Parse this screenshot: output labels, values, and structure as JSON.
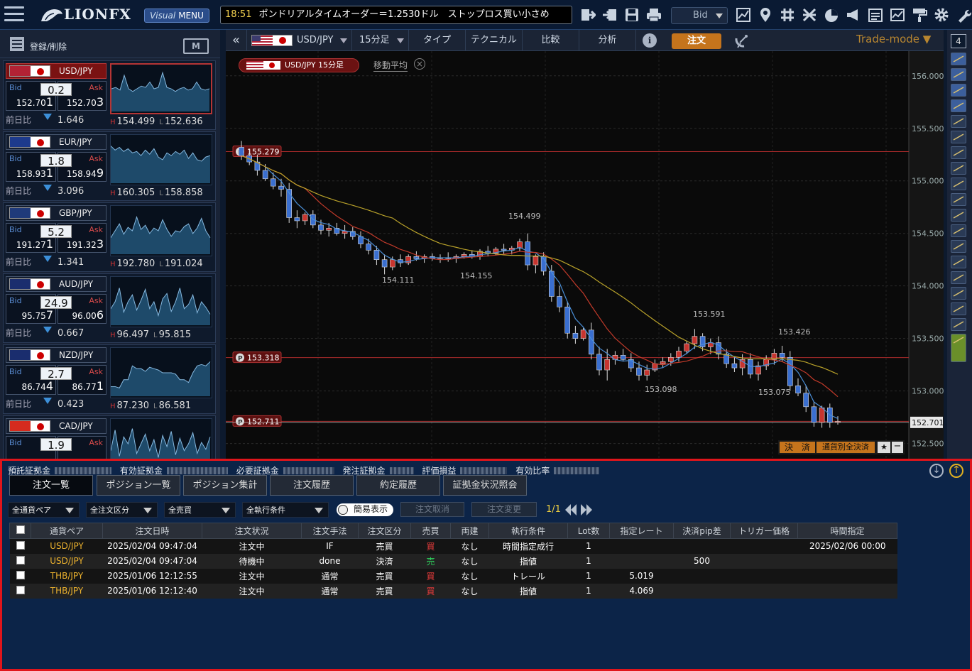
{
  "topbar": {
    "logo": "LIONFX",
    "visual_menu": {
      "italic": "Visual",
      "label": "MENU"
    },
    "ticker_time": "18:51",
    "ticker_text": "ポンドリアルタイムオーダー＝1.2530ドル　ストップロス買い小さめ",
    "bid_select": "Bid",
    "icons": [
      "logout-icon",
      "login-icon",
      "save-icon",
      "print-icon",
      "chart-icon",
      "map-pin-icon",
      "grid-icon",
      "scale-icon",
      "pie-icon",
      "megaphone-icon",
      "calendar-icon",
      "analysis-icon",
      "paint-roller-icon",
      "gear-icon",
      "wrench-icon"
    ]
  },
  "sidebar": {
    "label": "登録/削除",
    "m_label": "M",
    "pairs": [
      {
        "name": "USD/JPY",
        "spread": "0.2",
        "bid_main": "152.70",
        "bid_sub": "1",
        "ask_main": "152.70",
        "ask_sub": "3",
        "change": "1.646",
        "high": "154.499",
        "low": "152.636",
        "flag": "#b22234",
        "active": true
      },
      {
        "name": "EUR/JPY",
        "spread": "1.8",
        "bid_main": "158.93",
        "bid_sub": "1",
        "ask_main": "158.94",
        "ask_sub": "9",
        "change": "3.096",
        "high": "160.305",
        "low": "158.858",
        "flag": "#1d3a8c",
        "active": false
      },
      {
        "name": "GBP/JPY",
        "spread": "5.2",
        "bid_main": "191.27",
        "bid_sub": "1",
        "ask_main": "191.32",
        "ask_sub": "3",
        "change": "1.341",
        "high": "192.780",
        "low": "191.024",
        "flag": "#1f3a7a",
        "active": false
      },
      {
        "name": "AUD/JPY",
        "spread": "24.9",
        "bid_main": "95.75",
        "bid_sub": "7",
        "ask_main": "96.00",
        "ask_sub": "6",
        "change": "0.667",
        "high": "96.497",
        "low": "95.815",
        "flag": "#1a2d6e",
        "active": false
      },
      {
        "name": "NZD/JPY",
        "spread": "2.7",
        "bid_main": "86.74",
        "bid_sub": "4",
        "ask_main": "86.77",
        "ask_sub": "1",
        "change": "0.423",
        "high": "87.230",
        "low": "86.581",
        "flag": "#1a2d6e",
        "active": false
      },
      {
        "name": "CAD/JPY",
        "spread": "1.9",
        "bid_main": "",
        "bid_sub": "",
        "ask_main": "",
        "ask_sub": "",
        "change": "",
        "high": "",
        "low": "",
        "flag": "#d52b1e",
        "active": false
      }
    ],
    "labels": {
      "bid": "Bid",
      "ask": "Ask",
      "prev": "前日比",
      "h": "H",
      "l": "L"
    }
  },
  "chartbar": {
    "pair": "USD/JPY",
    "interval": "15分足",
    "type": "タイプ",
    "technical": "テクニカル",
    "compare": "比較",
    "analysis": "分析",
    "order": "注文",
    "trade_mode": "Trade-mode ▼",
    "num": "4"
  },
  "chart": {
    "legend_pair": "USD/JPY 15分足",
    "legend_ma": "移動平均",
    "guide_prices": [
      "155.279",
      "153.318",
      "152.711"
    ],
    "yticks": [
      "156.000",
      "155.500",
      "155.000",
      "154.500",
      "154.000",
      "153.500",
      "153.000",
      "152.500"
    ],
    "current": "152.701",
    "annotations": [
      "154.499",
      "154.155",
      "154.111",
      "153.591",
      "153.426",
      "153.098",
      "153.075"
    ],
    "settle_label": "決　済",
    "settle_all_label": "通貨別全決済"
  },
  "chart_data": {
    "type": "candlestick",
    "ylim": [
      152.45,
      156.1
    ],
    "ma_labels": [
      "移動平均"
    ],
    "highs_lows": [
      {
        "label": "154.499",
        "value": 154.499
      },
      {
        "label": "154.155",
        "value": 154.155
      },
      {
        "label": "154.111",
        "value": 154.111
      },
      {
        "label": "153.591",
        "value": 153.591
      },
      {
        "label": "153.426",
        "value": 153.426
      },
      {
        "label": "153.098",
        "value": 153.098
      },
      {
        "label": "153.075",
        "value": 153.075
      }
    ],
    "ohlc": [
      [
        155.32,
        155.38,
        155.2,
        155.24
      ],
      [
        155.24,
        155.3,
        155.15,
        155.18
      ],
      [
        155.18,
        155.25,
        155.05,
        155.1
      ],
      [
        155.1,
        155.16,
        155.0,
        155.02
      ],
      [
        155.02,
        155.08,
        154.92,
        154.95
      ],
      [
        154.95,
        155.02,
        154.85,
        154.92
      ],
      [
        154.92,
        154.98,
        154.6,
        154.65
      ],
      [
        154.65,
        154.72,
        154.55,
        154.62
      ],
      [
        154.62,
        154.7,
        154.58,
        154.68
      ],
      [
        154.68,
        154.72,
        154.55,
        154.58
      ],
      [
        154.58,
        154.63,
        154.49,
        154.53
      ],
      [
        154.53,
        154.6,
        154.47,
        154.55
      ],
      [
        154.55,
        154.6,
        154.48,
        154.5
      ],
      [
        154.5,
        154.58,
        154.45,
        154.52
      ],
      [
        154.52,
        154.56,
        154.44,
        154.47
      ],
      [
        154.47,
        154.52,
        154.36,
        154.4
      ],
      [
        154.4,
        154.45,
        154.3,
        154.34
      ],
      [
        154.34,
        154.38,
        154.2,
        154.25
      ],
      [
        154.25,
        154.3,
        154.11,
        154.18
      ],
      [
        154.18,
        154.28,
        154.15,
        154.25
      ],
      [
        154.25,
        154.3,
        154.18,
        154.22
      ],
      [
        154.22,
        154.3,
        154.2,
        154.28
      ],
      [
        154.28,
        154.33,
        154.24,
        154.26
      ],
      [
        154.26,
        154.3,
        154.22,
        154.28
      ],
      [
        154.28,
        154.31,
        154.24,
        154.26
      ],
      [
        154.26,
        154.3,
        154.22,
        154.27
      ],
      [
        154.27,
        154.32,
        154.23,
        154.26
      ],
      [
        154.26,
        154.3,
        154.22,
        154.28
      ],
      [
        154.28,
        154.32,
        154.26,
        154.3
      ],
      [
        154.3,
        154.34,
        154.26,
        154.28
      ],
      [
        154.28,
        154.35,
        154.25,
        154.33
      ],
      [
        154.33,
        154.38,
        154.28,
        154.31
      ],
      [
        154.31,
        154.37,
        154.29,
        154.35
      ],
      [
        154.35,
        154.4,
        154.3,
        154.34
      ],
      [
        154.34,
        154.38,
        154.3,
        154.36
      ],
      [
        154.36,
        154.45,
        154.33,
        154.42
      ],
      [
        154.42,
        154.5,
        154.15,
        154.2
      ],
      [
        154.2,
        154.3,
        154.12,
        154.28
      ],
      [
        154.28,
        154.32,
        154.1,
        154.14
      ],
      [
        154.14,
        154.2,
        153.85,
        153.9
      ],
      [
        153.9,
        154.0,
        153.75,
        153.8
      ],
      [
        153.8,
        153.85,
        153.5,
        153.55
      ],
      [
        153.55,
        153.62,
        153.45,
        153.5
      ],
      [
        153.5,
        153.6,
        153.48,
        153.58
      ],
      [
        153.58,
        153.65,
        153.3,
        153.35
      ],
      [
        153.35,
        153.42,
        153.15,
        153.2
      ],
      [
        153.2,
        153.4,
        153.1,
        153.3
      ],
      [
        153.3,
        153.38,
        153.25,
        153.34
      ],
      [
        153.34,
        153.4,
        153.28,
        153.3
      ],
      [
        153.3,
        153.36,
        153.18,
        153.22
      ],
      [
        153.22,
        153.28,
        153.1,
        153.15
      ],
      [
        153.15,
        153.25,
        153.1,
        153.2
      ],
      [
        153.2,
        153.3,
        153.18,
        153.26
      ],
      [
        153.26,
        153.32,
        153.22,
        153.28
      ],
      [
        153.28,
        153.36,
        153.24,
        153.32
      ],
      [
        153.32,
        153.42,
        153.28,
        153.38
      ],
      [
        153.38,
        153.48,
        153.35,
        153.45
      ],
      [
        153.45,
        153.59,
        153.4,
        153.52
      ],
      [
        153.52,
        153.55,
        153.38,
        153.42
      ],
      [
        153.42,
        153.5,
        153.35,
        153.46
      ],
      [
        153.46,
        153.52,
        153.3,
        153.35
      ],
      [
        153.35,
        153.4,
        153.22,
        153.26
      ],
      [
        153.26,
        153.33,
        153.18,
        153.22
      ],
      [
        153.22,
        153.35,
        153.15,
        153.3
      ],
      [
        153.3,
        153.36,
        153.12,
        153.16
      ],
      [
        153.16,
        153.28,
        153.1,
        153.24
      ],
      [
        153.24,
        153.34,
        153.2,
        153.3
      ],
      [
        153.3,
        153.4,
        153.25,
        153.36
      ],
      [
        153.36,
        153.43,
        153.28,
        153.32
      ],
      [
        153.32,
        153.38,
        153.0,
        153.05
      ],
      [
        153.05,
        153.12,
        152.95,
        152.98
      ],
      [
        152.98,
        153.05,
        152.8,
        152.85
      ],
      [
        152.85,
        152.9,
        152.66,
        152.7
      ],
      [
        152.7,
        152.86,
        152.65,
        152.84
      ],
      [
        152.84,
        152.88,
        152.65,
        152.7
      ],
      [
        152.7,
        152.76,
        152.68,
        152.71
      ]
    ]
  },
  "funds": {
    "items": [
      "預託証拠金",
      "有効証拠金",
      "必要証拠金",
      "発注証拠金",
      "評価損益",
      "有効比率"
    ]
  },
  "tabs": [
    "注文一覧",
    "ポジション一覧",
    "ポジション集計",
    "注文履歴",
    "約定履歴",
    "証拠金状況照会"
  ],
  "filters": {
    "pair": "全通貨ペア",
    "order_type": "全注文区分",
    "side": "全売買",
    "condition": "全執行条件",
    "simple": "簡易表示",
    "cancel": "注文取消",
    "change": "注文変更",
    "page": "1/1"
  },
  "table": {
    "headers": [
      "通貨ペア",
      "注文日時",
      "注文状況",
      "注文手法",
      "注文区分",
      "売買",
      "両建",
      "執行条件",
      "Lot数",
      "指定レート",
      "決済pip差",
      "トリガー価格",
      "時間指定"
    ],
    "rows": [
      [
        "USD/JPY",
        "2025/02/04 09:47:04",
        "注文中",
        "IF",
        "売買",
        "買",
        "なし",
        "時間指定成行",
        "1",
        "",
        "",
        "",
        "2025/02/06 00:00"
      ],
      [
        "USD/JPY",
        "2025/02/04 09:47:04",
        "待機中",
        "done",
        "決済",
        "売",
        "なし",
        "指値",
        "1",
        "",
        "500",
        "",
        ""
      ],
      [
        "THB/JPY",
        "2025/01/06 12:12:55",
        "注文中",
        "通常",
        "売買",
        "買",
        "なし",
        "トレール",
        "1",
        "5.019",
        "",
        "",
        ""
      ],
      [
        "THB/JPY",
        "2025/01/06 12:12:40",
        "注文中",
        "通常",
        "売買",
        "買",
        "なし",
        "指値",
        "1",
        "4.069",
        "",
        "",
        ""
      ]
    ]
  }
}
